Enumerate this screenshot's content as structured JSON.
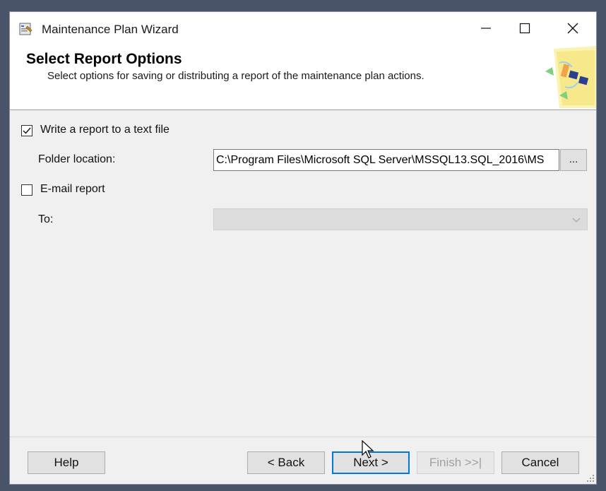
{
  "window": {
    "title": "Maintenance Plan Wizard"
  },
  "header": {
    "title": "Select Report Options",
    "subtitle": "Select options for saving or distributing a report of the maintenance plan actions."
  },
  "options": {
    "write_report": {
      "label": "Write a report to a text file",
      "checked": true
    },
    "folder_location": {
      "label": "Folder location:",
      "value": "C:\\Program Files\\Microsoft SQL Server\\MSSQL13.SQL_2016\\MS",
      "browse_label": "..."
    },
    "email_report": {
      "label": "E-mail report",
      "checked": false
    },
    "to": {
      "label": "To:",
      "value": ""
    }
  },
  "footer": {
    "help": "Help",
    "back": "< Back",
    "next": "Next >",
    "finish": "Finish >>|",
    "cancel": "Cancel"
  }
}
